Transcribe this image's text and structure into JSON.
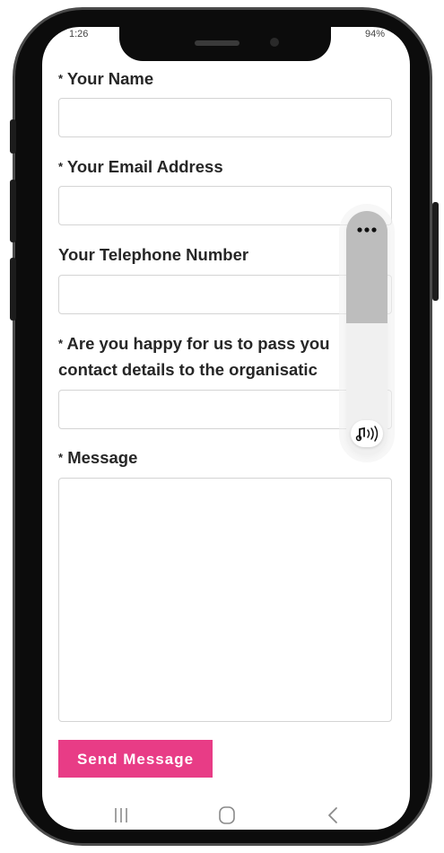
{
  "status_bar": {
    "time": "1:26",
    "battery": "94%"
  },
  "form": {
    "name_label": "Your Name",
    "email_label": "Your Email Address",
    "phone_label": "Your Telephone Number",
    "consent_label_line1": "Are you happy for us to pass you",
    "consent_label_line2": "contact details to the organisatic",
    "message_label": "Message",
    "required_marker": "*",
    "name_value": "",
    "email_value": "",
    "phone_value": "",
    "consent_value": "",
    "message_value": "",
    "send_label": "Send Message"
  },
  "floating_widget": {
    "menu_icon": "more-horizontal-icon",
    "audio_icon": "music-sound-icon"
  },
  "nav": {
    "recent_icon": "recent-apps-icon",
    "home_icon": "home-icon",
    "back_icon": "back-icon"
  },
  "colors": {
    "accent": "#e83c86",
    "text": "#262626",
    "border": "#d4d4d4"
  }
}
